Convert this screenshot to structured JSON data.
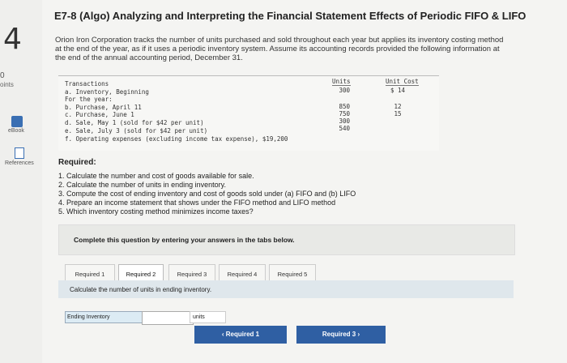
{
  "question": {
    "number": "4",
    "title": "E7-8 (Algo) Analyzing and Interpreting the Financial Statement Effects of Periodic FIFO & LIFO",
    "intro_lines": [
      "Orion Iron Corporation tracks the number of units purchased and sold throughout each year but applies its inventory costing method",
      "at the end of the year, as if it uses a periodic inventory system. Assume its accounting records provided the following information at",
      "the end of the annual accounting period, December 31."
    ]
  },
  "sidebar": {
    "points_value": "0",
    "points_label": "oints",
    "ebook_label": "eBook",
    "references_label": "References"
  },
  "transactions": {
    "header": "Transactions",
    "units_header": "Units",
    "cost_header": "Unit Cost",
    "rows": [
      {
        "label": "a. Inventory, Beginning",
        "units": "300",
        "cost": "$ 14"
      },
      {
        "label": "For the year:",
        "units": "",
        "cost": ""
      },
      {
        "label": "b. Purchase, April 11",
        "units": "850",
        "cost": "12"
      },
      {
        "label": "c. Purchase, June 1",
        "units": "750",
        "cost": "15"
      },
      {
        "label": "d. Sale, May 1 (sold for $42 per unit)",
        "units": "300",
        "cost": ""
      },
      {
        "label": "e. Sale, July 3 (sold for $42 per unit)",
        "units": "540",
        "cost": ""
      },
      {
        "label": "f. Operating expenses (excluding income tax expense), $19,200",
        "units": "",
        "cost": ""
      }
    ]
  },
  "required": {
    "heading": "Required:",
    "items": [
      "1. Calculate the number and cost of goods available for sale.",
      "2. Calculate the number of units in ending inventory.",
      "3. Compute the cost of ending inventory and cost of goods sold under (a) FIFO and (b) LIFO",
      "4. Prepare an income statement that shows under the FIFO method and LIFO method",
      "5. Which inventory costing method minimizes income taxes?"
    ]
  },
  "instructions": "Complete this question by entering your answers in the tabs below.",
  "tabs": [
    "Required 1",
    "Required 2",
    "Required 3",
    "Required 4",
    "Required 5"
  ],
  "active_tab_index": 1,
  "panel": {
    "prompt": "Calculate the number of units in ending inventory.",
    "field_label": "Ending Inventory",
    "field_value": "",
    "unit_label": "units"
  },
  "nav": {
    "prev_label": "Required 1",
    "next_label": "Required 3"
  },
  "colors": {
    "accent": "#2f5fa3",
    "panel_bg": "#dfe7ec"
  }
}
